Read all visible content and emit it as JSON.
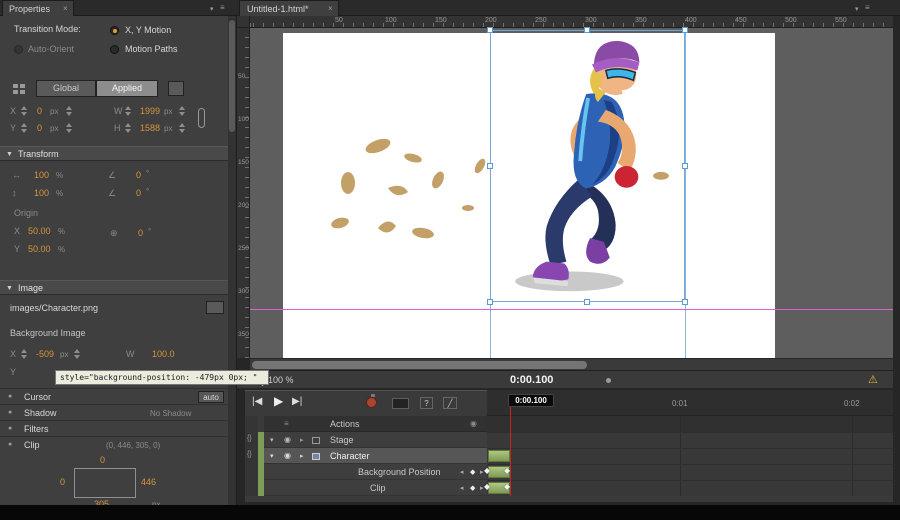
{
  "icons": {
    "close": "×",
    "menu_lines": "≡",
    "tri_down": "▾",
    "tri_right": "▸",
    "collapse": "▼",
    "warning": "⚠",
    "skip_start": "|◀",
    "play": "▶",
    "skip_end": "▶|",
    "question": "?",
    "diagonal": "╱",
    "keyframe": "◆",
    "eye": "◉",
    "braces": "{}",
    "scale_h": "↔",
    "scale_v": "↕",
    "skew": "∠",
    "origin": "⊕",
    "prev_kf": "◂",
    "next_kf": "▸",
    "dot": "●"
  },
  "units": {
    "px": "px",
    "pct": "%",
    "deg": "°"
  },
  "properties": {
    "tab_title": "Properties",
    "transition_mode_label": "Transition Mode:",
    "xy_motion_label": "X, Y Motion",
    "motion_paths_label": "Motion Paths",
    "auto_orient_label": "Auto-Orient",
    "global_button": "Global",
    "applied_button": "Applied",
    "x_label": "X",
    "y_label": "Y",
    "w_label": "W",
    "h_label": "H",
    "x_value": "0",
    "y_value": "0",
    "w_value": "1999",
    "h_value": "1588",
    "transform_header": "Transform",
    "scale_x": "100",
    "scale_y": "100",
    "skew_x": "0",
    "skew_y": "0",
    "rotate": "0",
    "origin_label": "Origin",
    "origin_x_label": "X",
    "origin_y_label": "Y",
    "origin_x": "50.00",
    "origin_y": "50.00",
    "image_header": "Image",
    "image_src": "images/Character.png",
    "bg_image_label": "Background Image",
    "bg_x_label": "X",
    "bg_y_label": "Y",
    "bg_w_label": "W",
    "bg_x_value": "-509",
    "bg_w_value": "100.0",
    "tooltip": "style=\"background-position: -479px 0px; \"",
    "cursor_label": "Cursor",
    "cursor_value": "auto",
    "shadow_label": "Shadow",
    "shadow_value": "No Shadow",
    "filters_label": "Filters",
    "clip_label": "Clip",
    "clip_value": "(0, 446, 305, 0)",
    "clip_top": "0",
    "clip_left": "0",
    "clip_right": "446",
    "clip_bottom": "305"
  },
  "stage": {
    "tab_title": "Untitled-1.html*",
    "zoom": "100 %",
    "timecode": "0:00.100",
    "ruler_h": [
      "50",
      "100",
      "150",
      "200",
      "250",
      "300",
      "350",
      "400",
      "450",
      "500",
      "550"
    ],
    "ruler_v": [
      "50",
      "100",
      "150",
      "200",
      "250",
      "300",
      "350"
    ]
  },
  "timeline": {
    "playhead_badge": "0:00.100",
    "tick_1": "0:01",
    "tick_2": "0:02",
    "actions_row_label": "Actions",
    "rows": [
      {
        "label": "Stage"
      },
      {
        "label": "Character"
      },
      {
        "label": "Background Position"
      },
      {
        "label": "Clip"
      }
    ]
  }
}
